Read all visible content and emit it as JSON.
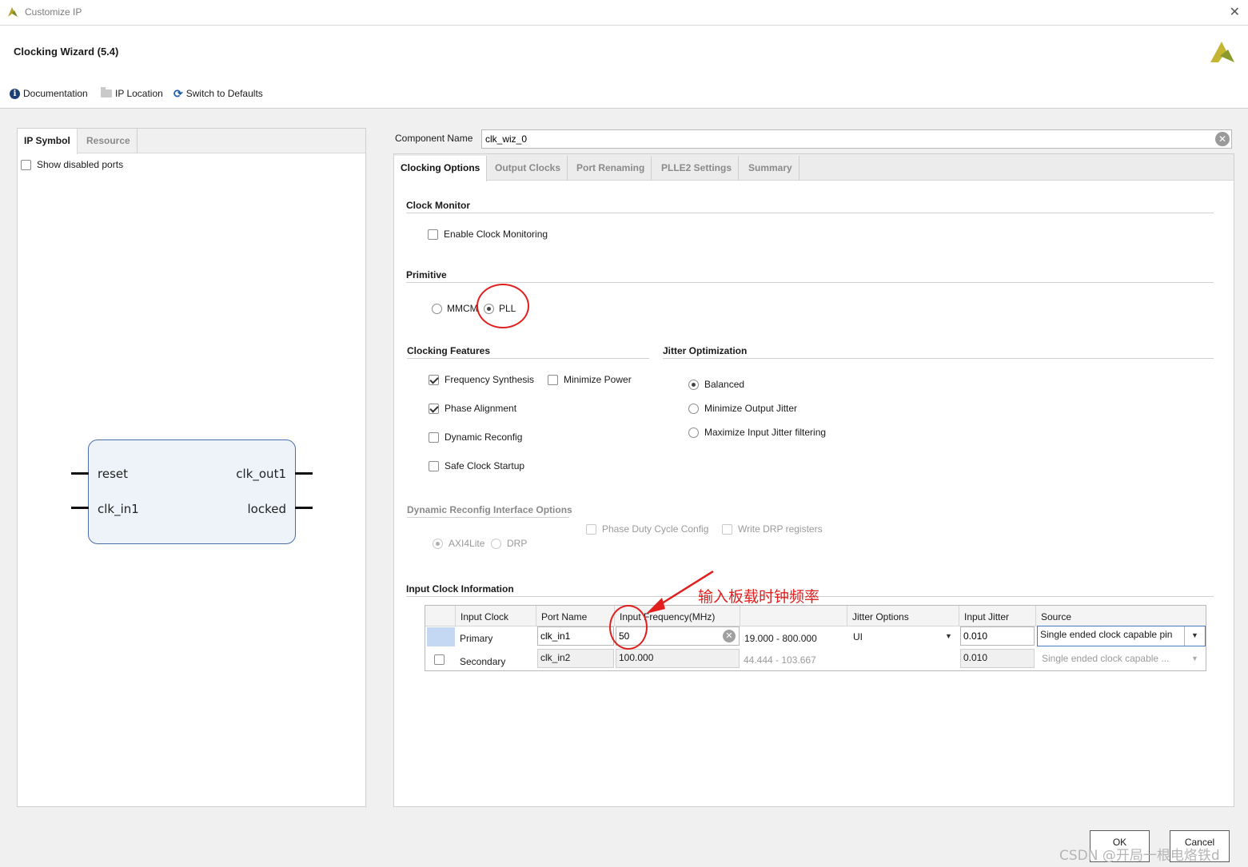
{
  "window": {
    "title": "Customize IP",
    "close_glyph": "✕"
  },
  "header": {
    "wizard_title": "Clocking Wizard (5.4)",
    "toolbar": {
      "documentation": "Documentation",
      "ip_location": "IP Location",
      "switch_to_defaults": "Switch to Defaults"
    }
  },
  "left_panel": {
    "tabs": [
      "IP Symbol",
      "Resource"
    ],
    "show_disabled_ports": "Show disabled ports",
    "ip_symbol": {
      "inputs": [
        "reset",
        "clk_in1"
      ],
      "outputs": [
        "clk_out1",
        "locked"
      ]
    }
  },
  "component": {
    "label": "Component Name",
    "value": "clk_wiz_0"
  },
  "right_tabs": [
    "Clocking Options",
    "Output Clocks",
    "Port Renaming",
    "PLLE2 Settings",
    "Summary"
  ],
  "clock_monitor": {
    "title": "Clock Monitor",
    "enable_label": "Enable Clock Monitoring",
    "enabled": false
  },
  "primitive": {
    "title": "Primitive",
    "options": [
      "MMCM",
      "PLL"
    ],
    "selected": "PLL"
  },
  "clocking_features": {
    "title": "Clocking Features",
    "frequency_synthesis": "Frequency Synthesis",
    "minimize_power": "Minimize Power",
    "phase_alignment": "Phase Alignment",
    "dynamic_reconfig": "Dynamic Reconfig",
    "safe_clock_startup": "Safe Clock Startup"
  },
  "jitter_optimization": {
    "title": "Jitter Optimization",
    "balanced": "Balanced",
    "minimize_output_jitter": "Minimize Output Jitter",
    "maximize_input_jitter": "Maximize Input Jitter filtering",
    "selected": "Balanced"
  },
  "dynamic_reconfig_interface": {
    "title": "Dynamic Reconfig Interface Options",
    "phase_duty_cycle": "Phase Duty Cycle Config",
    "write_drp": "Write DRP registers",
    "axi4lite": "AXI4Lite",
    "drp": "DRP"
  },
  "input_clock_info": {
    "title": "Input Clock Information",
    "headers": {
      "input_clock": "Input Clock",
      "port_name": "Port Name",
      "input_frequency": "Input Frequency(MHz)",
      "jitter_options": "Jitter Options",
      "input_jitter": "Input Jitter",
      "source": "Source"
    },
    "primary": {
      "label": "Primary",
      "port": "clk_in1",
      "freq": "50",
      "range": "19.000 - 800.000",
      "jitter_option": "UI",
      "jitter": "0.010",
      "source": "Single ended clock capable pin"
    },
    "secondary": {
      "label": "Secondary",
      "port": "clk_in2",
      "freq": "100.000",
      "range": "44.444 - 103.667",
      "jitter": "0.010",
      "source": "Single ended clock capable ..."
    }
  },
  "annotation": {
    "text": "输入板载时钟频率",
    "color": "#e0201e"
  },
  "buttons": {
    "ok": "OK",
    "cancel": "Cancel"
  },
  "watermark": "CSDN @开局一根电烙铁d"
}
